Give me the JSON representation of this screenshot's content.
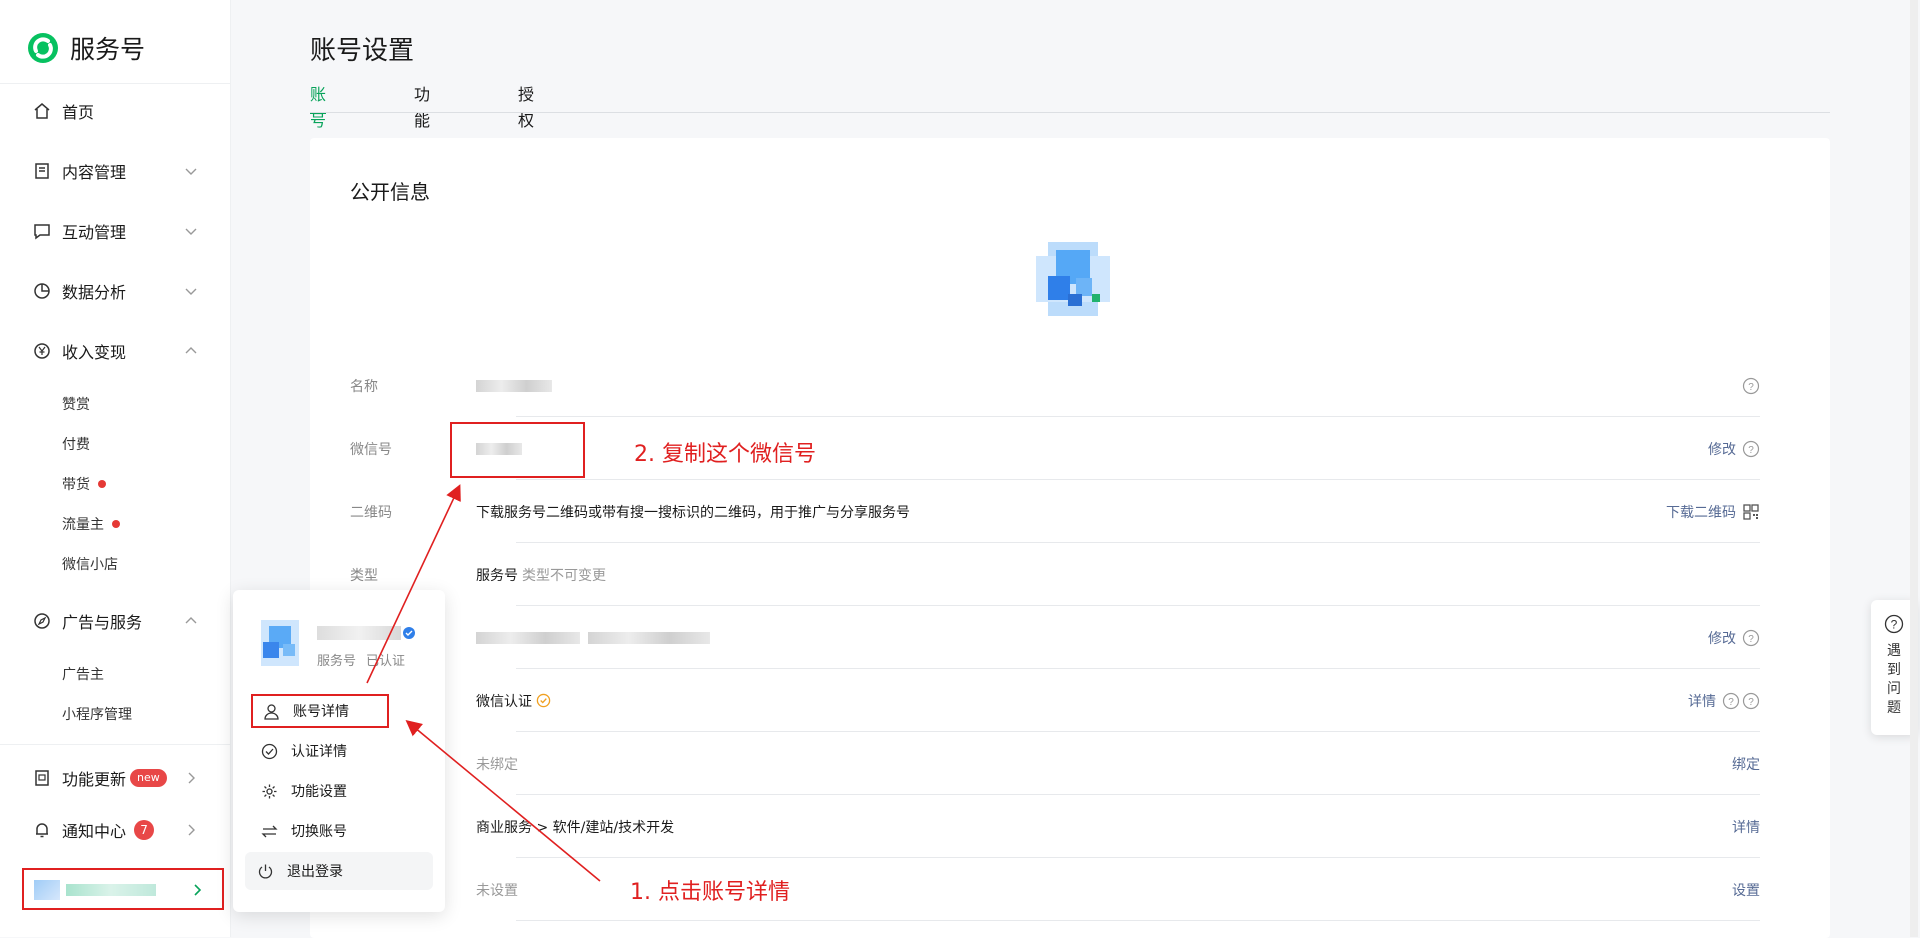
{
  "brand": {
    "name": "服务号"
  },
  "sidebar": {
    "home": "首页",
    "content": "内容管理",
    "interaction": "互动管理",
    "analytics": "数据分析",
    "monetization": "收入变现",
    "monetization_items": [
      "赞赏",
      "付费",
      "带货",
      "流量主",
      "微信小店"
    ],
    "ads": "广告与服务",
    "ads_items": [
      "广告主",
      "小程序管理"
    ],
    "updates": "功能更新",
    "updates_badge": "new",
    "notifications": "通知中心",
    "notifications_count": "7"
  },
  "popup": {
    "account_type": "服务号",
    "verified": "已认证",
    "items": [
      "账号详情",
      "认证详情",
      "功能设置",
      "切换账号",
      "退出登录"
    ]
  },
  "page": {
    "title": "账号设置",
    "tabs": [
      "账号详情",
      "功能设置",
      "授权管理"
    ]
  },
  "card": {
    "title": "公开信息",
    "rows": {
      "name_label": "名称",
      "wechat_label": "微信号",
      "wechat_action": "修改",
      "qr_label": "二维码",
      "qr_value": "下载服务号二维码或带有搜一搜标识的二维码，用于推广与分享服务号",
      "qr_action": "下载二维码",
      "type_label": "类型",
      "type_value": "服务号",
      "type_note": "类型不可变更",
      "intro_action": "修改",
      "cert_value": "微信认证",
      "cert_action": "详情",
      "bind_value": "未绑定",
      "bind_action": "绑定",
      "category_value": "商业服务 > 软件/建站/技术开发",
      "category_action": "详情",
      "setting_value": "未设置",
      "setting_action": "设置"
    }
  },
  "annotations": {
    "step1": "1. 点击账号详情",
    "step2": "2. 复制这个微信号"
  },
  "help": {
    "label": "遇到问题"
  },
  "colors": {
    "accent": "#07a35a",
    "annotation": "#e02020",
    "link": "#576b95",
    "badge": "#e84747"
  }
}
